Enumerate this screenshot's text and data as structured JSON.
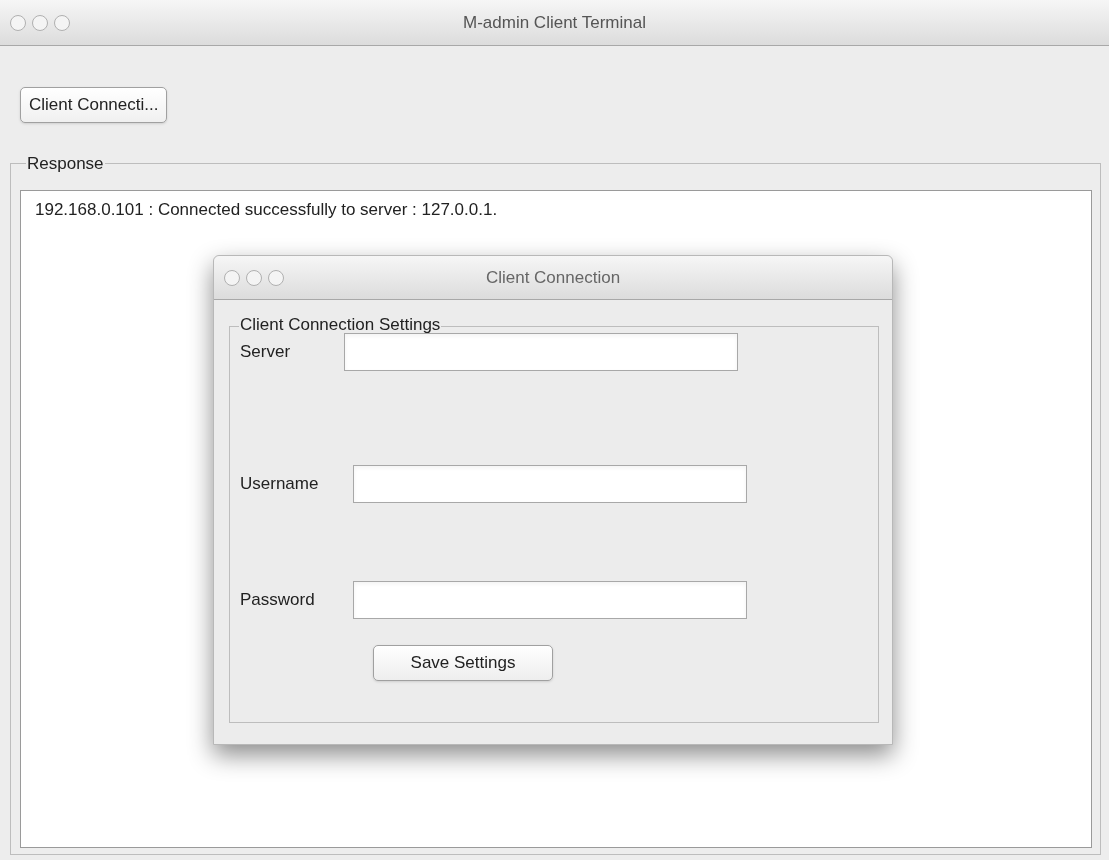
{
  "window": {
    "title": "M-admin Client Terminal"
  },
  "toolbar": {
    "button": "Client Connecti..."
  },
  "response": {
    "legend": "Response",
    "lines": [
      "192.168.0.101 : Connected successfully to server : 127.0.0.1."
    ]
  },
  "dialog": {
    "title": "Client Connection",
    "legend": "Client Connection Settings",
    "fields": [
      {
        "label": "Server"
      },
      {
        "label": "Username"
      },
      {
        "label": "Password"
      }
    ],
    "button": "Save Settings"
  }
}
